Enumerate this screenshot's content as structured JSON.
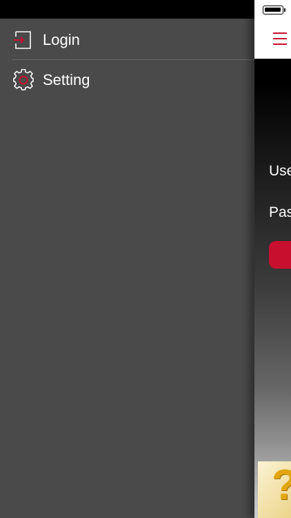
{
  "menu": {
    "items": [
      {
        "label": "Login",
        "icon": "login-icon"
      },
      {
        "label": "Setting",
        "icon": "gear-icon"
      }
    ]
  },
  "content": {
    "username_label": "Use",
    "password_label": "Pas",
    "help_glyph": "?"
  },
  "colors": {
    "accent": "#c8102e",
    "drawer_background": "#4a4a4a"
  }
}
